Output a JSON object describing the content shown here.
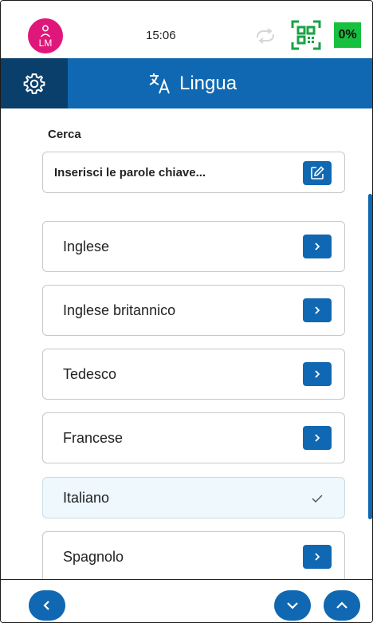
{
  "status_bar": {
    "avatar_initials": "LM",
    "time": "15:06",
    "battery": "0%",
    "colors": {
      "avatar": "#e0177a",
      "battery": "#18c040",
      "qr": "#1aa346"
    },
    "icons": [
      "user-avatar-icon",
      "sync-icon",
      "qr-code-icon"
    ]
  },
  "header": {
    "title": "Lingua",
    "icons": [
      "gear-icon",
      "translate-icon"
    ],
    "colors": {
      "bar": "#0f68b1",
      "settings_bg": "#0a3e6b"
    }
  },
  "search": {
    "label": "Cerca",
    "placeholder": "Inserisci le parole chiave...",
    "value": "",
    "icon": "edit-icon"
  },
  "languages": [
    {
      "label": "Inglese",
      "selected": false
    },
    {
      "label": "Inglese britannico",
      "selected": false
    },
    {
      "label": "Tedesco",
      "selected": false
    },
    {
      "label": "Francese",
      "selected": false
    },
    {
      "label": "Italiano",
      "selected": true
    },
    {
      "label": "Spagnolo",
      "selected": false
    }
  ],
  "footer": {
    "icons": [
      "chevron-left-icon",
      "chevron-down-icon",
      "chevron-up-icon"
    ]
  }
}
